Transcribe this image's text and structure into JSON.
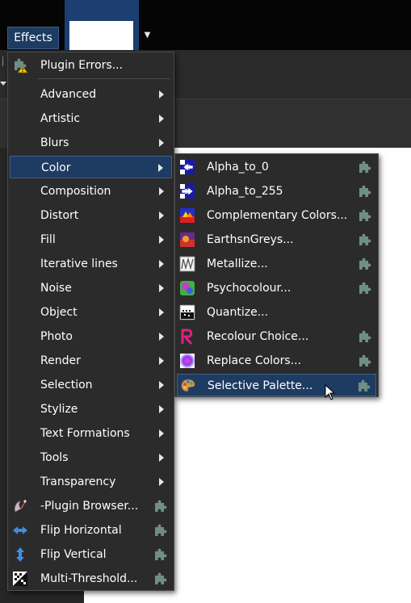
{
  "menubar": {
    "effects_label": "Effects"
  },
  "main_menu": {
    "plugin_errors": "Plugin Errors...",
    "items": [
      {
        "label": "Advanced"
      },
      {
        "label": "Artistic"
      },
      {
        "label": "Blurs"
      },
      {
        "label": "Color"
      },
      {
        "label": "Composition"
      },
      {
        "label": "Distort"
      },
      {
        "label": "Fill"
      },
      {
        "label": "Iterative lines"
      },
      {
        "label": "Noise"
      },
      {
        "label": "Object"
      },
      {
        "label": "Photo"
      },
      {
        "label": "Render"
      },
      {
        "label": "Selection"
      },
      {
        "label": "Stylize"
      },
      {
        "label": "Text Formations"
      },
      {
        "label": "Tools"
      },
      {
        "label": "Transparency"
      }
    ],
    "commands": [
      {
        "label": "-Plugin Browser...",
        "icon": "plugin-browser-icon"
      },
      {
        "label": "Flip Horizontal",
        "icon": "flip-horizontal-icon"
      },
      {
        "label": "Flip Vertical",
        "icon": "flip-vertical-icon"
      },
      {
        "label": "Multi-Threshold...",
        "icon": "multi-threshold-icon"
      }
    ],
    "highlighted": "Color"
  },
  "color_submenu": {
    "items": [
      {
        "label": "Alpha_to_0",
        "icon": "alpha-to-0-icon"
      },
      {
        "label": "Alpha_to_255",
        "icon": "alpha-to-255-icon"
      },
      {
        "label": "Complementary Colors...",
        "icon": "complementary-colors-icon"
      },
      {
        "label": "EarthsnGreys...",
        "icon": "earthsngreys-icon"
      },
      {
        "label": "Metallize...",
        "icon": "metallize-icon"
      },
      {
        "label": "Psychocolour...",
        "icon": "psychocolour-icon"
      },
      {
        "label": "Quantize...",
        "icon": "quantize-icon"
      },
      {
        "label": "Recolour Choice...",
        "icon": "recolour-choice-icon"
      },
      {
        "label": "Replace Colors...",
        "icon": "replace-colors-icon"
      },
      {
        "label": "Selective Palette...",
        "icon": "selective-palette-icon"
      }
    ],
    "highlighted": "Selective Palette..."
  },
  "colors": {
    "highlight": "#1e3b62",
    "menu_bg": "#2b2b2b",
    "plugin_badge": "#6f8f86"
  }
}
